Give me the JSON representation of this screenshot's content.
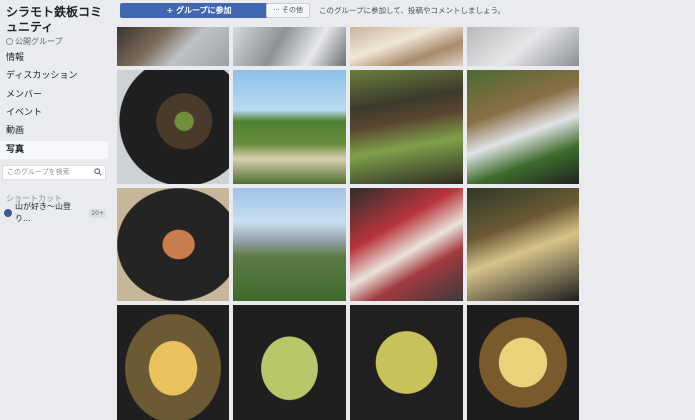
{
  "sidebar": {
    "group_name": "シラモト鉄板コミュニティ",
    "group_type": "公開グループ",
    "nav": [
      {
        "label": "情報"
      },
      {
        "label": "ディスカッション"
      },
      {
        "label": "メンバー"
      },
      {
        "label": "イベント"
      },
      {
        "label": "動画"
      },
      {
        "label": "写真",
        "active": true
      }
    ],
    "search_placeholder": "このグループを検索",
    "shortcuts_title": "ショートカット",
    "shortcut": {
      "label": "山が好き～山登り...",
      "badge": "20+"
    }
  },
  "topbar": {
    "join_label": "+ グループに参加",
    "more_label": "··· その他",
    "invite_text": "このグループに参加して、投稿やコメントしましょう。"
  },
  "photos": [
    "p1",
    "p2",
    "p3",
    "p4",
    "p5",
    "p6",
    "p7",
    "p8",
    "p9",
    "p10",
    "p11",
    "p12",
    "p13",
    "p14",
    "p15",
    "p16"
  ]
}
